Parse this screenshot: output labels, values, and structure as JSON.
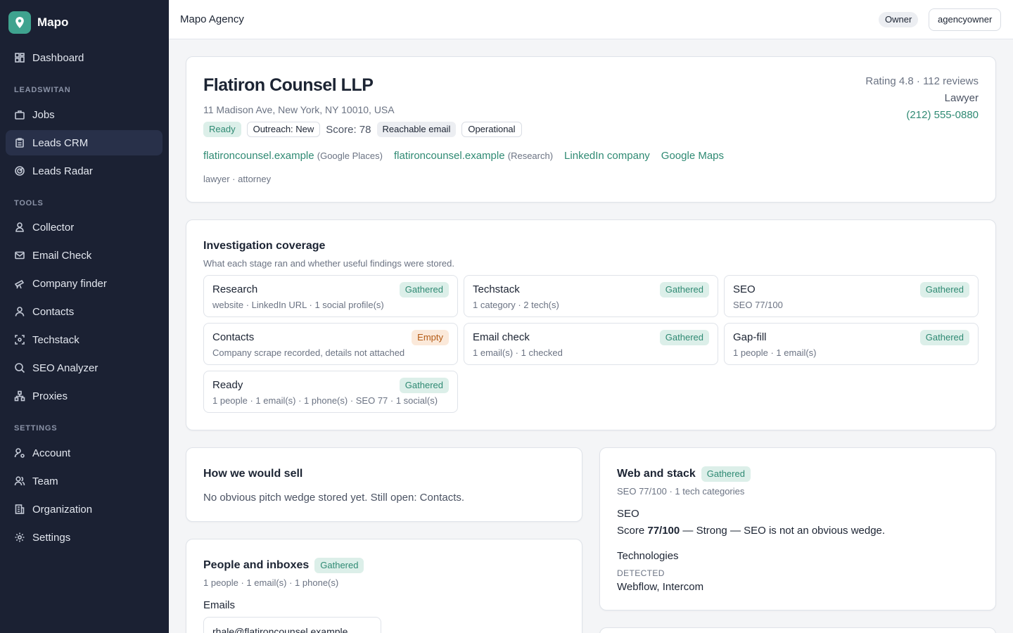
{
  "app": {
    "brand": "Mapo",
    "logo_icon": "map-pin-icon",
    "accent": "#3fa38f"
  },
  "sidebar": {
    "top_items": [
      {
        "label": "Dashboard",
        "icon": "dashboard-icon"
      }
    ],
    "sections": [
      {
        "title": "LEADSWITAN",
        "items": [
          {
            "label": "Jobs",
            "icon": "briefcase-icon"
          },
          {
            "label": "Leads CRM",
            "icon": "clipboard-icon",
            "active": true
          },
          {
            "label": "Leads Radar",
            "icon": "radar-icon"
          }
        ]
      },
      {
        "title": "TOOLS",
        "items": [
          {
            "label": "Collector",
            "icon": "collector-icon"
          },
          {
            "label": "Email Check",
            "icon": "mail-icon"
          },
          {
            "label": "Company finder",
            "icon": "telescope-icon"
          },
          {
            "label": "Contacts",
            "icon": "user-icon"
          },
          {
            "label": "Techstack",
            "icon": "scan-icon"
          },
          {
            "label": "SEO Analyzer",
            "icon": "search-icon"
          },
          {
            "label": "Proxies",
            "icon": "network-icon"
          }
        ]
      },
      {
        "title": "SETTINGS",
        "items": [
          {
            "label": "Account",
            "icon": "user-gear-icon"
          },
          {
            "label": "Team",
            "icon": "users-icon"
          },
          {
            "label": "Organization",
            "icon": "building-icon"
          },
          {
            "label": "Settings",
            "icon": "gear-icon"
          }
        ]
      }
    ]
  },
  "topbar": {
    "title": "Mapo Agency",
    "role": "Owner",
    "user": "agencyowner"
  },
  "lead": {
    "name": "Flatiron Counsel LLP",
    "address": "11 Madison Ave, New York, NY 10010, USA",
    "badges": {
      "status": "Ready",
      "outreach": "Outreach: New",
      "score": "Score: 78",
      "email": "Reachable email",
      "operational": "Operational"
    },
    "links": [
      {
        "text": "flatironcounsel.example",
        "source": "(Google Places)"
      },
      {
        "text": "flatironcounsel.example",
        "source": "(Research)"
      },
      {
        "text": "LinkedIn company",
        "source": ""
      },
      {
        "text": "Google Maps",
        "source": ""
      }
    ],
    "tags": "lawyer · attorney",
    "rating": "Rating 4.8 · 112 reviews",
    "category": "Lawyer",
    "phone": "(212) 555-0880"
  },
  "coverage": {
    "title": "Investigation coverage",
    "subtitle": "What each stage ran and whether useful findings were stored.",
    "stages": [
      {
        "title": "Research",
        "sub": "website · LinkedIn URL · 1 social profile(s)",
        "status": "Gathered"
      },
      {
        "title": "Techstack",
        "sub": "1 category · 2 tech(s)",
        "status": "Gathered"
      },
      {
        "title": "SEO",
        "sub": "SEO 77/100",
        "status": "Gathered"
      },
      {
        "title": "Contacts",
        "sub": "Company scrape recorded, details not attached",
        "status": "Empty"
      },
      {
        "title": "Email check",
        "sub": "1 email(s) · 1 checked",
        "status": "Gathered"
      },
      {
        "title": "Gap-fill",
        "sub": "1 people · 1 email(s)",
        "status": "Gathered"
      },
      {
        "title": "Ready",
        "sub": "1 people · 1 email(s) · 1 phone(s) · SEO 77 · 1 social(s)",
        "status": "Gathered"
      }
    ]
  },
  "sell": {
    "title": "How we would sell",
    "text": "No obvious pitch wedge stored yet. Still open: Contacts."
  },
  "people": {
    "title": "People and inboxes",
    "status": "Gathered",
    "summary": "1 people · 1 email(s) · 1 phone(s)",
    "emails_label": "Emails",
    "email_value": "rhale@flatironcounsel.example"
  },
  "web": {
    "title": "Web and stack",
    "status": "Gathered",
    "summary": "SEO 77/100 · 1 tech categories",
    "seo_label": "SEO",
    "seo_prefix": "Score ",
    "seo_score": "77/100",
    "seo_suffix": " — Strong — SEO is not an obvious wedge.",
    "tech_label": "Technologies",
    "detected_label": "DETECTED",
    "detected_value": "Webflow, Intercom"
  }
}
